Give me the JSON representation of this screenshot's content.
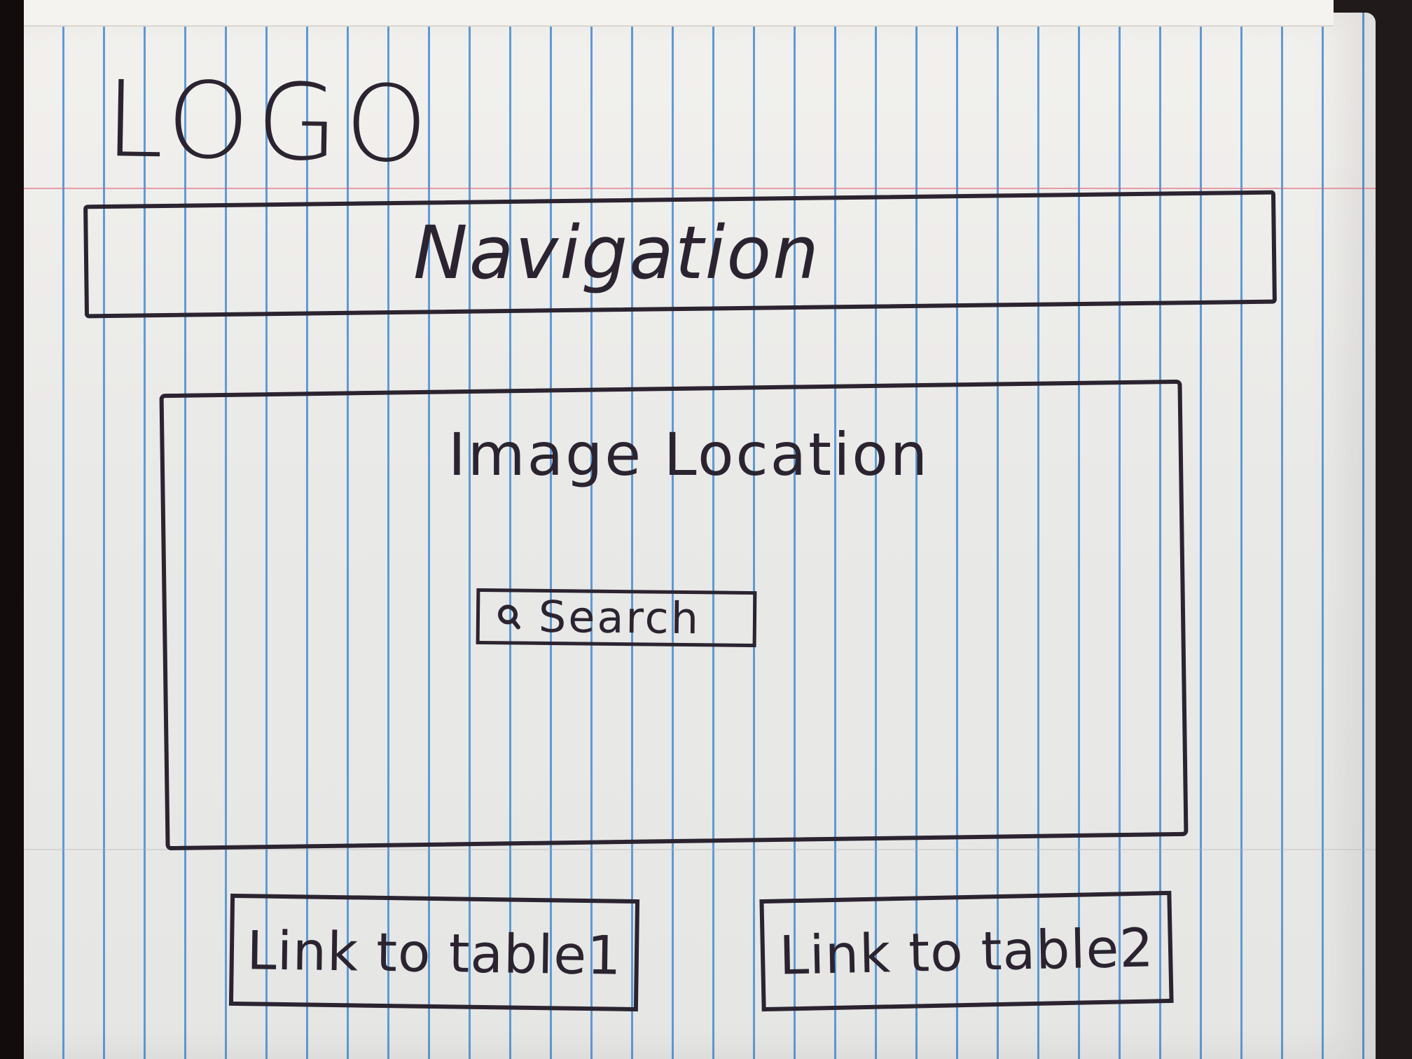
{
  "header": {
    "logo_text": "LOGO"
  },
  "navigation": {
    "label": "Navigation"
  },
  "hero": {
    "image_label": "Image Location",
    "search": {
      "label": "Search",
      "icon": "search-icon"
    }
  },
  "links": [
    {
      "label": "Link to table1"
    },
    {
      "label": "Link to table2"
    }
  ],
  "colors": {
    "ink": "#2b2430",
    "paper": "#eceae6",
    "rule_line": "#468cd2",
    "margin_line": "#dc5a6e"
  }
}
